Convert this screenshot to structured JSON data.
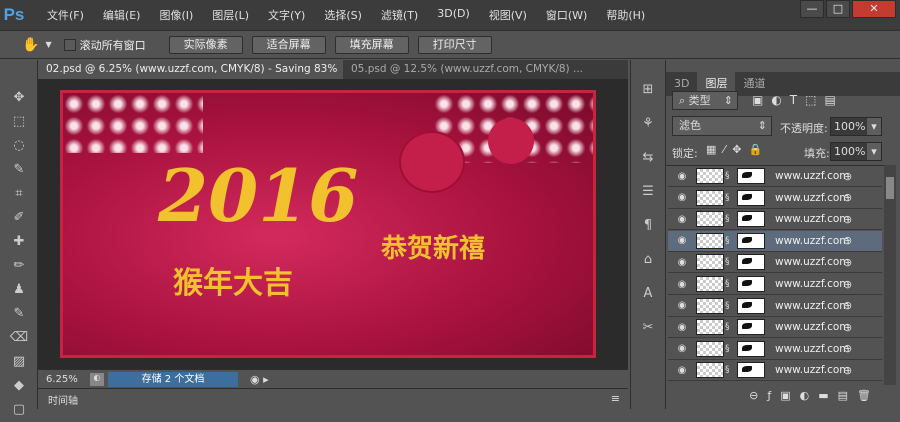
{
  "app": {
    "logo": "Ps"
  },
  "menu": [
    "文件(F)",
    "编辑(E)",
    "图像(I)",
    "图层(L)",
    "文字(Y)",
    "选择(S)",
    "滤镜(T)",
    "3D(D)",
    "视图(V)",
    "窗口(W)",
    "帮助(H)"
  ],
  "window_controls": [
    "—",
    "□",
    "✕"
  ],
  "options": {
    "scroll_all_label": "滚动所有窗口",
    "scroll_all_checked": false,
    "buttons": [
      "实际像素",
      "适合屏幕",
      "填充屏幕",
      "打印尺寸"
    ]
  },
  "tabs": [
    {
      "label": "02.psd @ 6.25% (www.uzzf.com, CMYK/8) - Saving 83%",
      "active": true
    },
    {
      "label": "05.psd @ 12.5% (www.uzzf.com, CMYK/8) ...",
      "active": false
    }
  ],
  "artwork": {
    "year": "2016",
    "greeting1": "猴年大吉",
    "greeting2": "恭贺新禧"
  },
  "status": {
    "zoom": "6.25%",
    "progress_label": "存储 2 个文档"
  },
  "timeline": {
    "label": "时间轴"
  },
  "panel": {
    "tabs": [
      "3D",
      "图层",
      "通道"
    ],
    "active_tab": "图层",
    "filter_kind": "类型",
    "blend_mode": "滤色",
    "opacity_label": "不透明度:",
    "opacity": "100%",
    "lock_label": "锁定:",
    "fill_label": "填充:",
    "fill": "100%"
  },
  "layers": [
    {
      "name": "www.uzzf.com",
      "selected": false
    },
    {
      "name": "www.uzzf.com",
      "selected": false
    },
    {
      "name": "www.uzzf.com",
      "selected": false
    },
    {
      "name": "www.uzzf.com",
      "selected": true
    },
    {
      "name": "www.uzzf.com",
      "selected": false
    },
    {
      "name": "www.uzzf.com",
      "selected": false
    },
    {
      "name": "www.uzzf.com",
      "selected": false
    },
    {
      "name": "www.uzzf.com",
      "selected": false
    },
    {
      "name": "www.uzzf.com",
      "selected": false
    },
    {
      "name": "www.uzzf.com",
      "selected": false
    }
  ],
  "colors": {
    "accent": "#4fa3e6",
    "progress": "#3d6f9e",
    "selected_layer": "#5d6b7c",
    "art_red": "#b8173f",
    "gold": "#f2c12e"
  }
}
